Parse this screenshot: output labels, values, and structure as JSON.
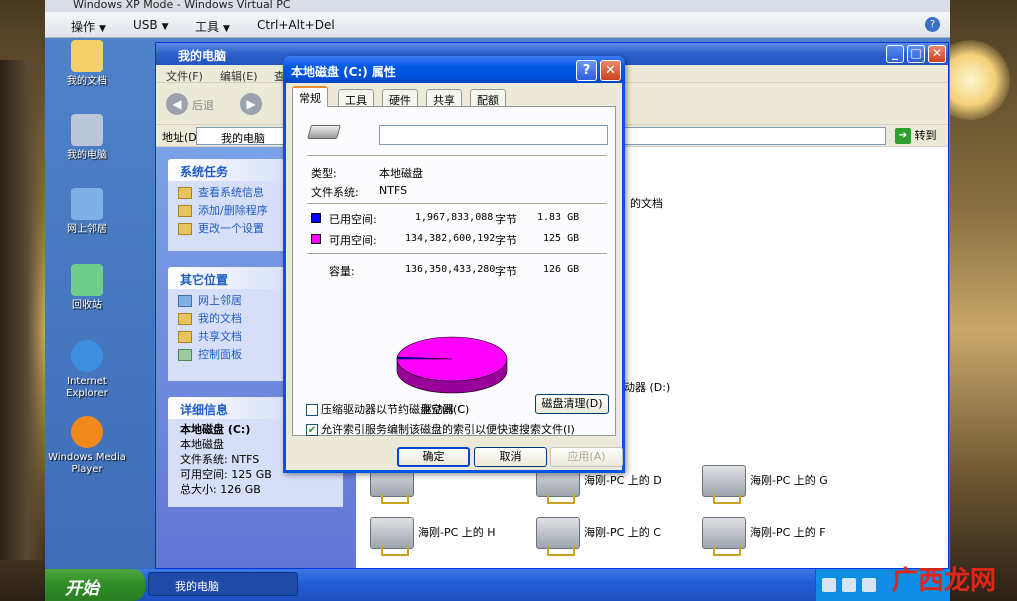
{
  "host": {
    "title": "Windows XP Mode - Windows Virtual PC",
    "menu": [
      "操作",
      "USB",
      "工具",
      "Ctrl+Alt+Del"
    ]
  },
  "desktop_icons": [
    "我的文档",
    "我的电脑",
    "网上邻居",
    "回收站",
    "Internet Explorer",
    "Windows Media Player"
  ],
  "explorer": {
    "title": "我的电脑",
    "menu": [
      "文件(F)",
      "编辑(E)",
      "查"
    ],
    "back_label": "后退",
    "address_label": "地址(D)",
    "address_value": "我的电脑",
    "go_label": "转到",
    "system_tasks": {
      "heading": "系统任务",
      "items": [
        "查看系统信息",
        "添加/删除程序",
        "更改一个设置"
      ]
    },
    "other_places": {
      "heading": "其它位置",
      "items": [
        "网上邻居",
        "我的文档",
        "共享文档",
        "控制面板"
      ]
    },
    "details": {
      "heading": "详细信息",
      "name": "本地磁盘 (C:)",
      "type": "本地磁盘",
      "fs": "文件系统: NTFS",
      "free": "可用空间: 125 GB",
      "total": "总大小: 126 GB"
    },
    "content": {
      "docs_partial": "的文档",
      "drive_partial": "动器 (D:)",
      "network_drives": [
        "海刚-PC 上的 D",
        "海刚-PC 上的 G",
        "海刚-PC 上的 H",
        "海刚-PC 上的 C",
        "海刚-PC 上的 F"
      ]
    }
  },
  "dialog": {
    "title": "本地磁盘 (C:) 属性",
    "tabs": [
      "常规",
      "工具",
      "硬件",
      "共享",
      "配额"
    ],
    "volume_label": "",
    "type_label": "类型:",
    "type_value": "本地磁盘",
    "fs_label": "文件系统:",
    "fs_value": "NTFS",
    "used_label": "已用空间:",
    "used_bytes": "1,967,833,088",
    "used_unit": "字节",
    "used_gb": "1.83 GB",
    "free_label": "可用空间:",
    "free_bytes": "134,382,600,192",
    "free_unit": "字节",
    "free_gb": "125 GB",
    "cap_label": "容量:",
    "cap_bytes": "136,350,433,280",
    "cap_unit": "字节",
    "cap_gb": "126 GB",
    "drive_caption": "驱动器 C",
    "cleanup_button": "磁盘清理(D)",
    "compress_label": "压缩驱动器以节约磁盘空间(C)",
    "compress_checked": false,
    "index_label": "允许索引服务编制该磁盘的索引以便快速搜索文件(I)",
    "index_checked": true,
    "ok": "确定",
    "cancel": "取消",
    "apply": "应用(A)",
    "used_fraction": 0.0144,
    "colors": {
      "used": "#0000ff",
      "free": "#ff00ff"
    }
  },
  "taskbar": {
    "start": "开始",
    "task": "我的电脑"
  },
  "watermark": "广西龙网"
}
